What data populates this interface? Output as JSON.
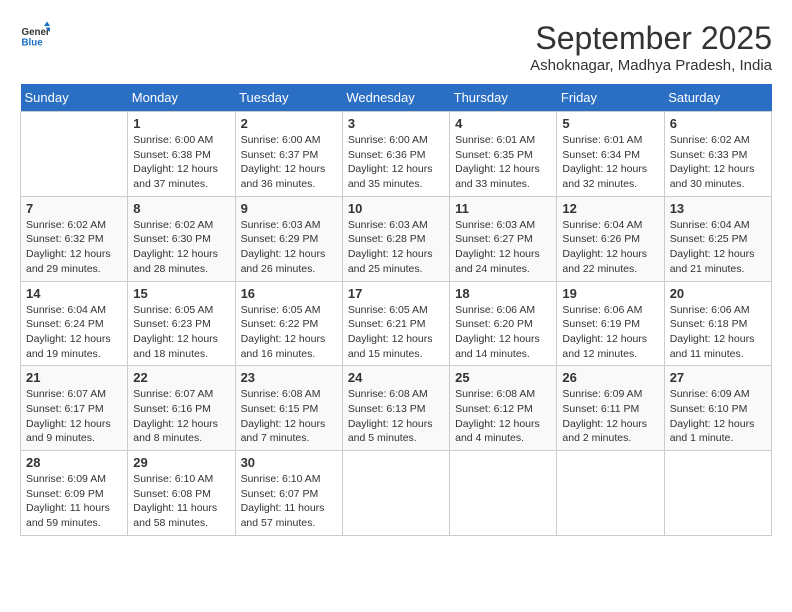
{
  "header": {
    "logo_line1": "General",
    "logo_line2": "Blue",
    "month": "September 2025",
    "location": "Ashoknagar, Madhya Pradesh, India"
  },
  "weekdays": [
    "Sunday",
    "Monday",
    "Tuesday",
    "Wednesday",
    "Thursday",
    "Friday",
    "Saturday"
  ],
  "weeks": [
    [
      {
        "day": "",
        "info": ""
      },
      {
        "day": "1",
        "info": "Sunrise: 6:00 AM\nSunset: 6:38 PM\nDaylight: 12 hours\nand 37 minutes."
      },
      {
        "day": "2",
        "info": "Sunrise: 6:00 AM\nSunset: 6:37 PM\nDaylight: 12 hours\nand 36 minutes."
      },
      {
        "day": "3",
        "info": "Sunrise: 6:00 AM\nSunset: 6:36 PM\nDaylight: 12 hours\nand 35 minutes."
      },
      {
        "day": "4",
        "info": "Sunrise: 6:01 AM\nSunset: 6:35 PM\nDaylight: 12 hours\nand 33 minutes."
      },
      {
        "day": "5",
        "info": "Sunrise: 6:01 AM\nSunset: 6:34 PM\nDaylight: 12 hours\nand 32 minutes."
      },
      {
        "day": "6",
        "info": "Sunrise: 6:02 AM\nSunset: 6:33 PM\nDaylight: 12 hours\nand 30 minutes."
      }
    ],
    [
      {
        "day": "7",
        "info": "Sunrise: 6:02 AM\nSunset: 6:32 PM\nDaylight: 12 hours\nand 29 minutes."
      },
      {
        "day": "8",
        "info": "Sunrise: 6:02 AM\nSunset: 6:30 PM\nDaylight: 12 hours\nand 28 minutes."
      },
      {
        "day": "9",
        "info": "Sunrise: 6:03 AM\nSunset: 6:29 PM\nDaylight: 12 hours\nand 26 minutes."
      },
      {
        "day": "10",
        "info": "Sunrise: 6:03 AM\nSunset: 6:28 PM\nDaylight: 12 hours\nand 25 minutes."
      },
      {
        "day": "11",
        "info": "Sunrise: 6:03 AM\nSunset: 6:27 PM\nDaylight: 12 hours\nand 24 minutes."
      },
      {
        "day": "12",
        "info": "Sunrise: 6:04 AM\nSunset: 6:26 PM\nDaylight: 12 hours\nand 22 minutes."
      },
      {
        "day": "13",
        "info": "Sunrise: 6:04 AM\nSunset: 6:25 PM\nDaylight: 12 hours\nand 21 minutes."
      }
    ],
    [
      {
        "day": "14",
        "info": "Sunrise: 6:04 AM\nSunset: 6:24 PM\nDaylight: 12 hours\nand 19 minutes."
      },
      {
        "day": "15",
        "info": "Sunrise: 6:05 AM\nSunset: 6:23 PM\nDaylight: 12 hours\nand 18 minutes."
      },
      {
        "day": "16",
        "info": "Sunrise: 6:05 AM\nSunset: 6:22 PM\nDaylight: 12 hours\nand 16 minutes."
      },
      {
        "day": "17",
        "info": "Sunrise: 6:05 AM\nSunset: 6:21 PM\nDaylight: 12 hours\nand 15 minutes."
      },
      {
        "day": "18",
        "info": "Sunrise: 6:06 AM\nSunset: 6:20 PM\nDaylight: 12 hours\nand 14 minutes."
      },
      {
        "day": "19",
        "info": "Sunrise: 6:06 AM\nSunset: 6:19 PM\nDaylight: 12 hours\nand 12 minutes."
      },
      {
        "day": "20",
        "info": "Sunrise: 6:06 AM\nSunset: 6:18 PM\nDaylight: 12 hours\nand 11 minutes."
      }
    ],
    [
      {
        "day": "21",
        "info": "Sunrise: 6:07 AM\nSunset: 6:17 PM\nDaylight: 12 hours\nand 9 minutes."
      },
      {
        "day": "22",
        "info": "Sunrise: 6:07 AM\nSunset: 6:16 PM\nDaylight: 12 hours\nand 8 minutes."
      },
      {
        "day": "23",
        "info": "Sunrise: 6:08 AM\nSunset: 6:15 PM\nDaylight: 12 hours\nand 7 minutes."
      },
      {
        "day": "24",
        "info": "Sunrise: 6:08 AM\nSunset: 6:13 PM\nDaylight: 12 hours\nand 5 minutes."
      },
      {
        "day": "25",
        "info": "Sunrise: 6:08 AM\nSunset: 6:12 PM\nDaylight: 12 hours\nand 4 minutes."
      },
      {
        "day": "26",
        "info": "Sunrise: 6:09 AM\nSunset: 6:11 PM\nDaylight: 12 hours\nand 2 minutes."
      },
      {
        "day": "27",
        "info": "Sunrise: 6:09 AM\nSunset: 6:10 PM\nDaylight: 12 hours\nand 1 minute."
      }
    ],
    [
      {
        "day": "28",
        "info": "Sunrise: 6:09 AM\nSunset: 6:09 PM\nDaylight: 11 hours\nand 59 minutes."
      },
      {
        "day": "29",
        "info": "Sunrise: 6:10 AM\nSunset: 6:08 PM\nDaylight: 11 hours\nand 58 minutes."
      },
      {
        "day": "30",
        "info": "Sunrise: 6:10 AM\nSunset: 6:07 PM\nDaylight: 11 hours\nand 57 minutes."
      },
      {
        "day": "",
        "info": ""
      },
      {
        "day": "",
        "info": ""
      },
      {
        "day": "",
        "info": ""
      },
      {
        "day": "",
        "info": ""
      }
    ]
  ]
}
